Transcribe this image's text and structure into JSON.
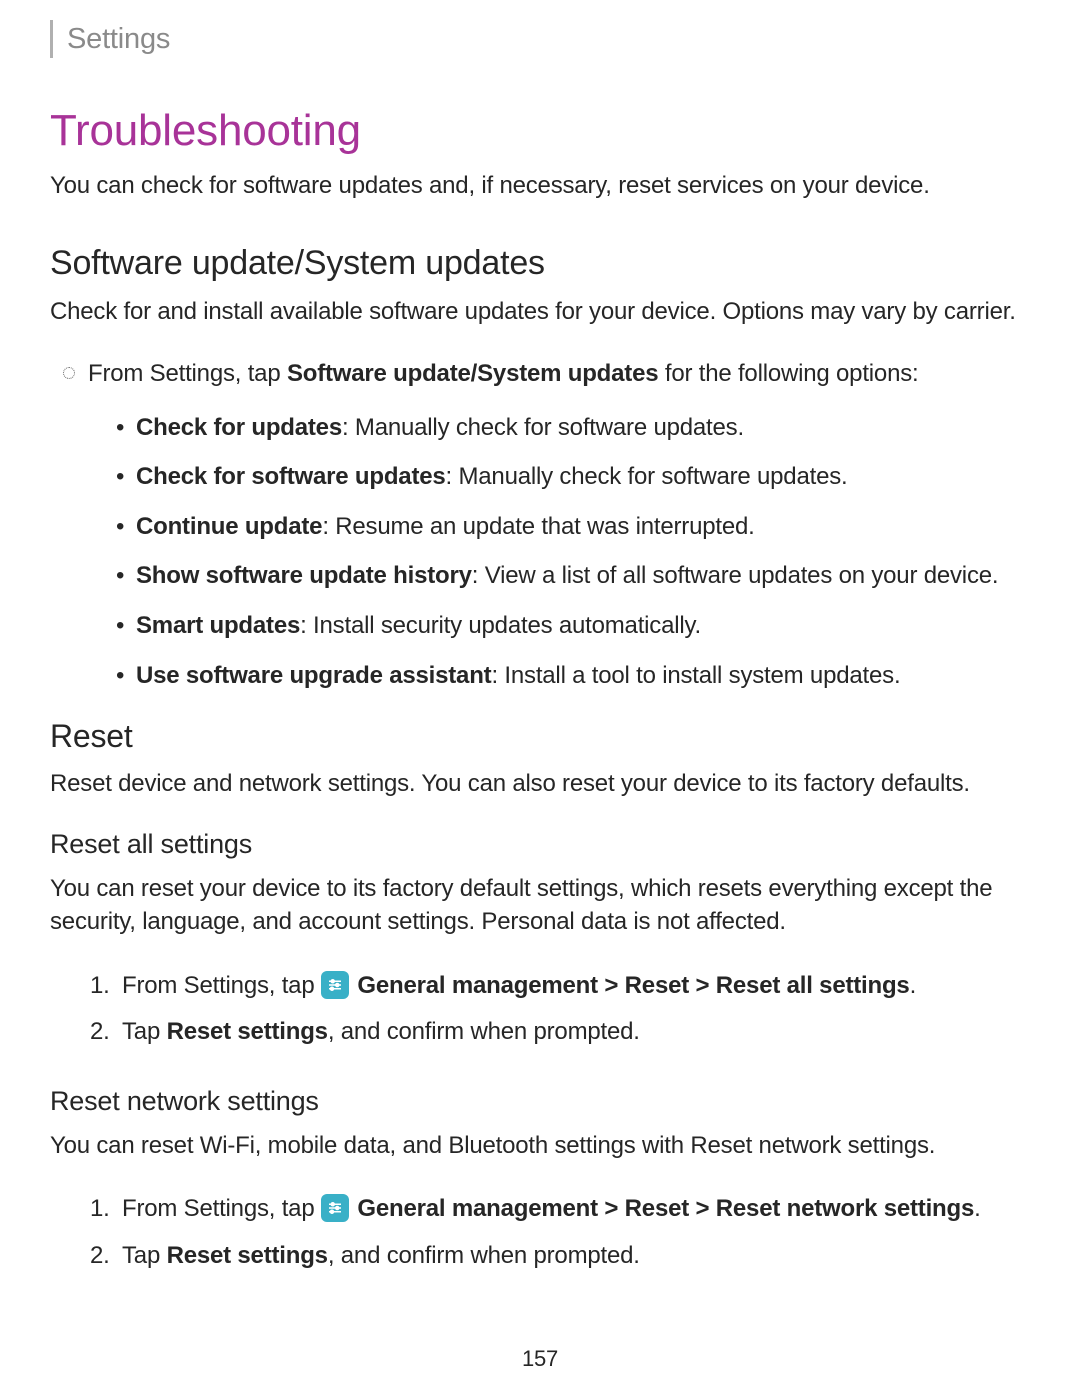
{
  "header": "Settings",
  "title": "Troubleshooting",
  "intro": "You can check for software updates and, if necessary, reset services on your device.",
  "softwareUpdate": {
    "heading": "Software update/System updates",
    "desc": "Check for and install available software updates for your device. Options may vary by carrier.",
    "leadPrefix": "From Settings, tap ",
    "leadBold": "Software update/System updates",
    "leadSuffix": " for the following options:",
    "items": [
      {
        "bold": "Check for updates",
        "rest": ": Manually check for software updates."
      },
      {
        "bold": "Check for software updates",
        "rest": ": Manually check for software updates."
      },
      {
        "bold": "Continue update",
        "rest": ": Resume an update that was interrupted."
      },
      {
        "bold": "Show software update history",
        "rest": ": View a list of all software updates on your device."
      },
      {
        "bold": "Smart updates",
        "rest": ": Install security updates automatically."
      },
      {
        "bold": "Use software upgrade assistant",
        "rest": ": Install a tool to install system updates."
      }
    ]
  },
  "reset": {
    "heading": "Reset",
    "desc": "Reset device and network settings. You can also reset your device to its factory defaults."
  },
  "resetAll": {
    "heading": "Reset all settings",
    "desc": "You can reset your device to its factory default settings, which resets everything except the security, language, and account settings. Personal data is not affected.",
    "step1Prefix": "From Settings, tap ",
    "step1Path": " General management > Reset > Reset all settings",
    "step1End": ".",
    "step2Prefix": "Tap ",
    "step2Bold": "Reset settings",
    "step2Rest": ", and confirm when prompted."
  },
  "resetNetwork": {
    "heading": "Reset network settings",
    "desc": "You can reset Wi-Fi, mobile data, and Bluetooth settings with Reset network settings.",
    "step1Prefix": "From Settings, tap ",
    "step1Path": " General management > Reset > Reset network settings",
    "step1End": ".",
    "step2Prefix": "Tap ",
    "step2Bold": "Reset settings",
    "step2Rest": ", and confirm when prompted."
  },
  "pageNumber": "157"
}
